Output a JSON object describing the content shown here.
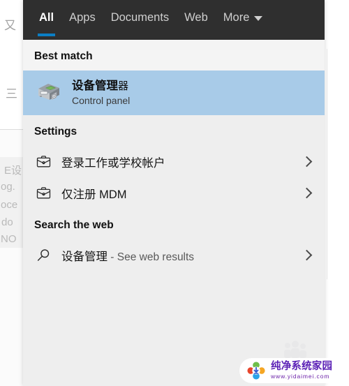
{
  "header": {
    "tabs": [
      {
        "label": "All",
        "active": true
      },
      {
        "label": "Apps",
        "active": false
      },
      {
        "label": "Documents",
        "active": false
      },
      {
        "label": "Web",
        "active": false
      },
      {
        "label": "More",
        "active": false
      }
    ],
    "more_icon": "chevron-down-icon",
    "background_color": "#2f2f2f",
    "active_indicator_color": "#0b7ec4"
  },
  "sections": {
    "best_match": {
      "heading": "Best match",
      "item": {
        "icon": "device-manager-icon",
        "title_bold": "设备管理",
        "title_tail": "器",
        "subtitle": "Control panel",
        "highlight_color": "#a8cbe8"
      }
    },
    "settings": {
      "heading": "Settings",
      "items": [
        {
          "icon": "briefcase-icon",
          "label": "登录工作或学校帐户",
          "chevron": "chevron-right-icon"
        },
        {
          "icon": "briefcase-icon",
          "label": "仅注册 MDM",
          "chevron": "chevron-right-icon"
        }
      ]
    },
    "search_web": {
      "heading": "Search the web",
      "items": [
        {
          "icon": "search-icon",
          "query": "设备管理",
          "separator": " - ",
          "suffix": "See web results",
          "chevron": "chevron-right-icon"
        }
      ]
    }
  },
  "background": {
    "fragments": [
      "又",
      "三",
      "E设",
      "og.",
      "oce",
      "do",
      "NO"
    ]
  },
  "watermark": {
    "name": "纯净系统家园",
    "url": "www.yidaimei.com",
    "brand_color": "#5b21b6"
  }
}
